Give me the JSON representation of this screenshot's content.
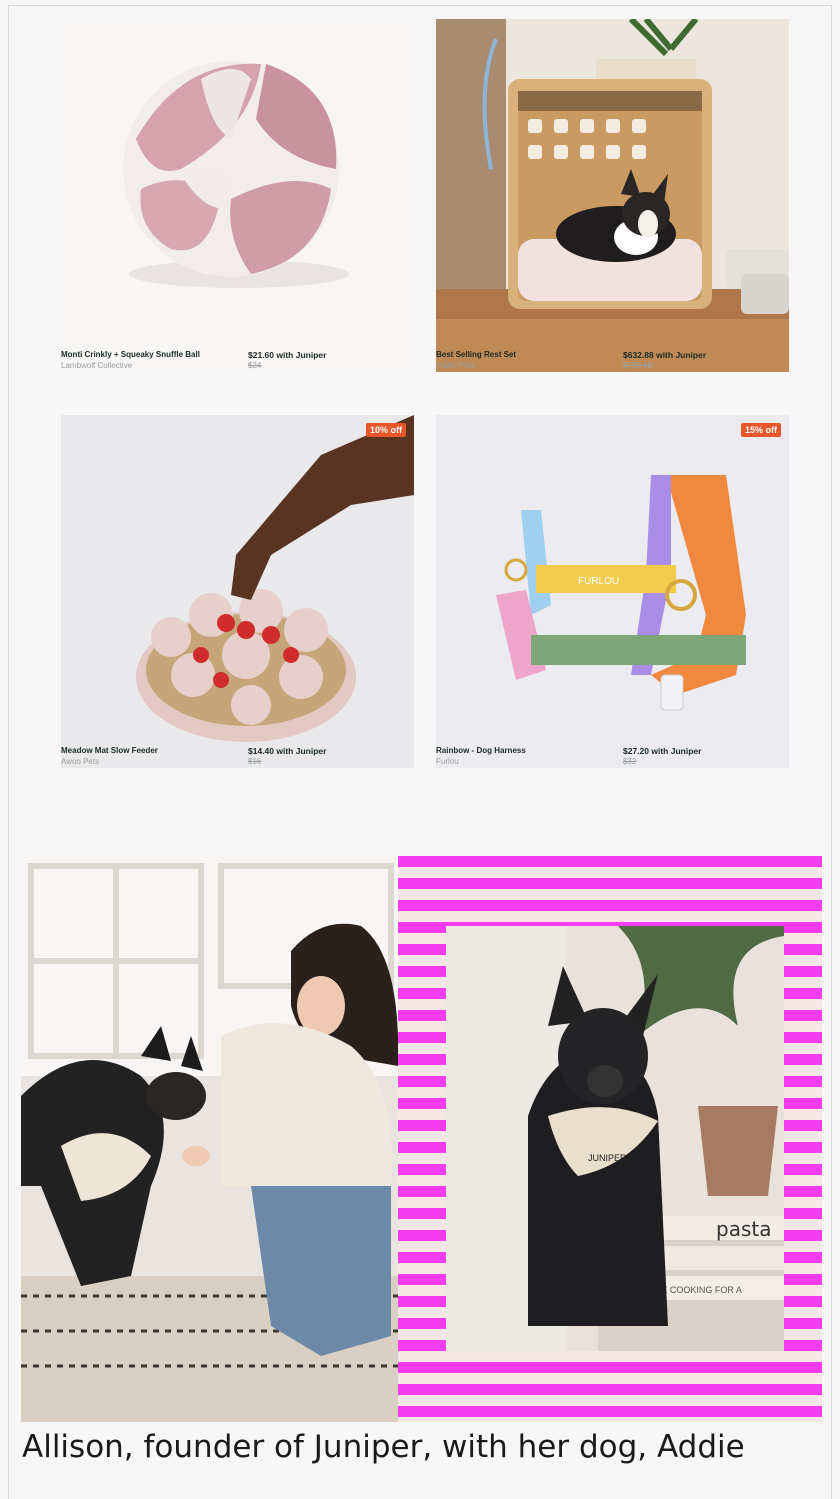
{
  "products": [
    {
      "name": "Monti Crinkly + Squeaky Snuffle Ball",
      "brand": "Lambwolf Collective",
      "price": "$21.60 with Juniper",
      "original_price": "$24",
      "image": "snuffle-ball-image",
      "badge": ""
    },
    {
      "name": "Best Selling Rest Set",
      "brand": "Fable Pets",
      "price": "$632.88 with Juniper",
      "original_price": "$791.10",
      "image": "dog-crate-image",
      "badge": ""
    },
    {
      "name": "Meadow Mat Slow Feeder",
      "brand": "Awoo Pets",
      "price": "$14.40 with Juniper",
      "original_price": "$16",
      "image": "slow-feeder-image",
      "badge": "10% off"
    },
    {
      "name": "Rainbow - Dog Harness",
      "brand": "Furlou",
      "price": "$27.20 with Juniper",
      "original_price": "$32",
      "image": "dog-harness-image",
      "badge": "15% off"
    }
  ],
  "feature": {
    "caption": "Allison, founder of Juniper, with her dog, Addie",
    "harness_logo_text": "FURLOU",
    "bandana_text": "JUNIPER",
    "book_text": "pasta",
    "book2_text": "MINA STONE COOKING FOR A"
  },
  "colors": {
    "badge": "#e8562a",
    "stripe_pink": "#f53cf0",
    "stripe_light": "#f6e7e6",
    "text_dark": "#1c2b24",
    "text_muted": "#9aa29e"
  }
}
